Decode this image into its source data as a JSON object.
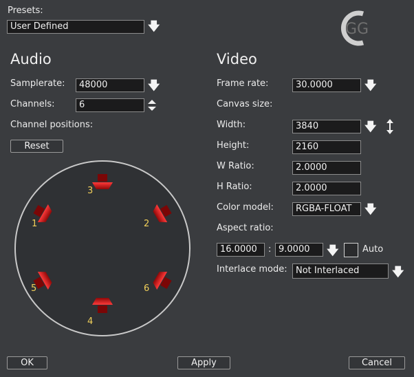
{
  "presets": {
    "label": "Presets:",
    "value": "User Defined"
  },
  "logo": {
    "text": "GG"
  },
  "audio": {
    "heading": "Audio",
    "samplerate_label": "Samplerate:",
    "samplerate_value": "48000",
    "channels_label": "Channels:",
    "channels_value": "6",
    "positions_label": "Channel positions:",
    "reset_label": "Reset",
    "speakers": [
      {
        "num": "3"
      },
      {
        "num": "1"
      },
      {
        "num": "2"
      },
      {
        "num": "5"
      },
      {
        "num": "6"
      },
      {
        "num": "4"
      }
    ]
  },
  "video": {
    "heading": "Video",
    "framerate_label": "Frame rate:",
    "framerate_value": "30.0000",
    "canvas_label": "Canvas size:",
    "width_label": "Width:",
    "width_value": "3840",
    "height_label": "Height:",
    "height_value": "2160",
    "wratio_label": "W Ratio:",
    "wratio_value": "2.0000",
    "hratio_label": "H Ratio:",
    "hratio_value": "2.0000",
    "colormodel_label": "Color model:",
    "colormodel_value": "RGBA-FLOAT",
    "aspect_label": "Aspect ratio:",
    "aspect_w": "16.0000",
    "aspect_sep": ":",
    "aspect_h": "9.0000",
    "auto_label": "Auto",
    "interlace_label": "Interlace mode:",
    "interlace_value": "Not Interlaced"
  },
  "buttons": {
    "ok": "OK",
    "apply": "Apply",
    "cancel": "Cancel"
  },
  "icons": {
    "dropdown": "down-arrow-icon",
    "spinner": "up-down-spinner-icon",
    "swap": "swap-dimensions-icon",
    "speaker": "speaker-icon"
  },
  "colors": {
    "background": "#3a3c3f",
    "speaker": "#e01818",
    "channel_number": "#f2d05a"
  }
}
